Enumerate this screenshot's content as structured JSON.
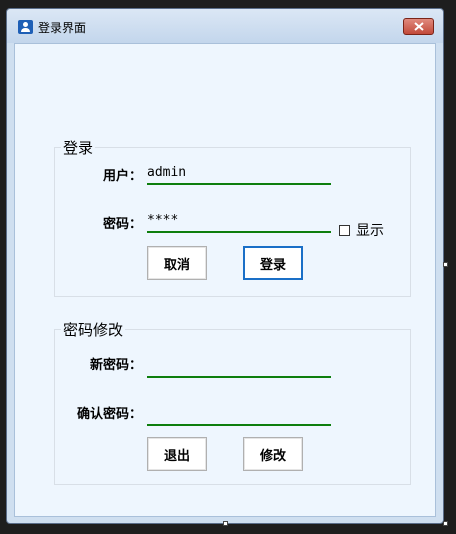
{
  "window": {
    "title": "登录界面"
  },
  "login": {
    "group_title": "登录",
    "username_label": "用户：",
    "username_value": "admin",
    "password_label": "密码：",
    "password_value": "****",
    "show_label": "显示",
    "show_checked": false,
    "cancel_label": "取消",
    "login_label": "登录"
  },
  "change_password": {
    "group_title": "密码修改",
    "new_password_label": "新密码：",
    "new_password_value": "",
    "confirm_password_label": "确认密码：",
    "confirm_password_value": "",
    "exit_label": "退出",
    "modify_label": "修改"
  },
  "icons": {
    "app": "user-icon",
    "close": "close-icon"
  },
  "colors": {
    "field_underline": "#0d7e0d",
    "primary_border": "#1a6fc7",
    "close_button": "#c24a3a"
  }
}
